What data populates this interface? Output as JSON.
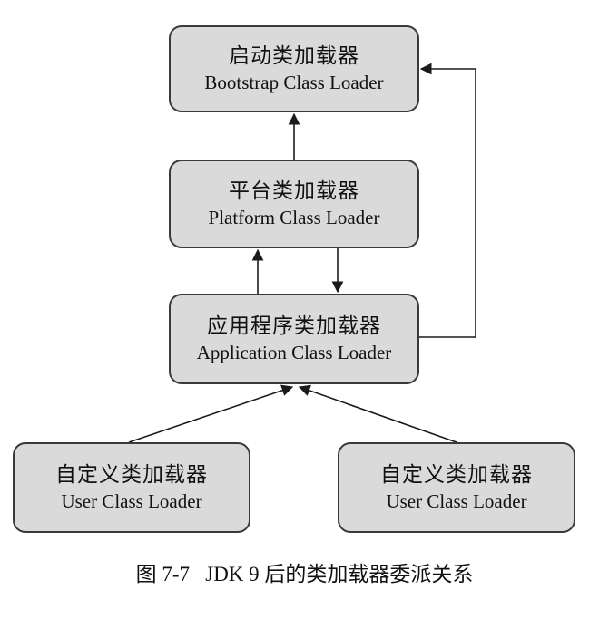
{
  "nodes": {
    "bootstrap": {
      "zh": "启动类加载器",
      "en": "Bootstrap Class Loader"
    },
    "platform": {
      "zh": "平台类加载器",
      "en": "Platform Class Loader"
    },
    "application": {
      "zh": "应用程序类加载器",
      "en": "Application Class Loader"
    },
    "user_left": {
      "zh": "自定义类加载器",
      "en": "User Class Loader"
    },
    "user_right": {
      "zh": "自定义类加载器",
      "en": "User Class Loader"
    }
  },
  "caption": "图 7-7   JDK 9 后的类加载器委派关系",
  "colors": {
    "node_fill": "#dadada",
    "node_border": "#3a3a3a",
    "line": "#1a1a1a"
  }
}
